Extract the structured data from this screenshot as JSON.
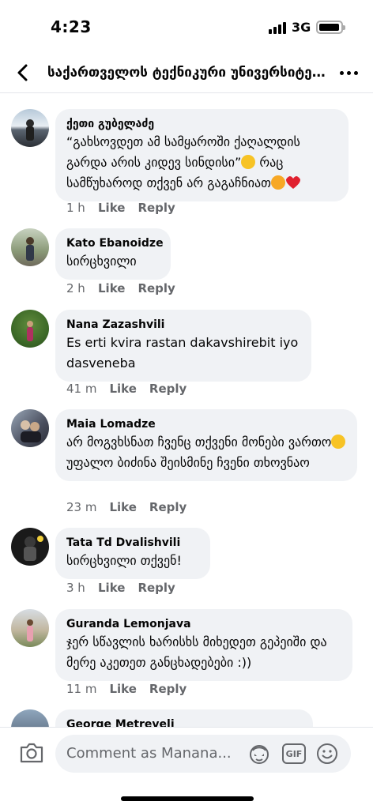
{
  "status_bar": {
    "time": "4:23",
    "network": "3G"
  },
  "header": {
    "title": "საქართველოს ტექნიკური უნივერსიტეტ..."
  },
  "comments": [
    {
      "author": "ქეთი გუბელაძე",
      "text_a": "“გახსოვდეთ ამ სამყაროში ქაღალდის გარდა არის კიდევ სინდისი”",
      "text_b": " რაც სამწუხაროდ თქვენ არ გაგაჩნიათ",
      "time": "1 h",
      "like": "Like",
      "reply": "Reply"
    },
    {
      "author": "Kato Ebanoidze",
      "text": "სირცხვილი",
      "time": "2 h",
      "like": "Like",
      "reply": "Reply"
    },
    {
      "author": "Nana Zazashvili",
      "text": "Es erti kvira rastan dakavshirebit iyo dasveneba",
      "time": "41 m",
      "like": "Like",
      "reply": "Reply"
    },
    {
      "author": "Maia Lomadze",
      "text_a": "არ მოგვხსნათ ჩვენც თქვენი მონები ვართო",
      "text_b": "უფალო ბიძინა შეისმინე ჩვენი თხოვნაო",
      "time": "23 m",
      "like": "Like",
      "reply": "Reply"
    },
    {
      "author": "Tata Td Dvalishvili",
      "text": "სირცხვილი თქვენ!",
      "time": "3 h",
      "like": "Like",
      "reply": "Reply"
    },
    {
      "author": "Guranda Lemonjava",
      "text": "ჯერ სწავლის ხარისხს მიხედეთ გეპეიში და მერე აკეთეთ განცხადებები :))",
      "time": "11 m",
      "like": "Like",
      "reply": "Reply"
    },
    {
      "author": "George Metreveli"
    }
  ],
  "composer": {
    "placeholder": "Comment as Manana...",
    "gif_label": "GIF"
  },
  "icons": {
    "back": "chevron-left-icon",
    "more": "more-horizontal-icon",
    "camera": "camera-icon",
    "avatar": "avatar-sticker-icon",
    "gif": "gif-icon",
    "emoji": "smiley-icon"
  }
}
